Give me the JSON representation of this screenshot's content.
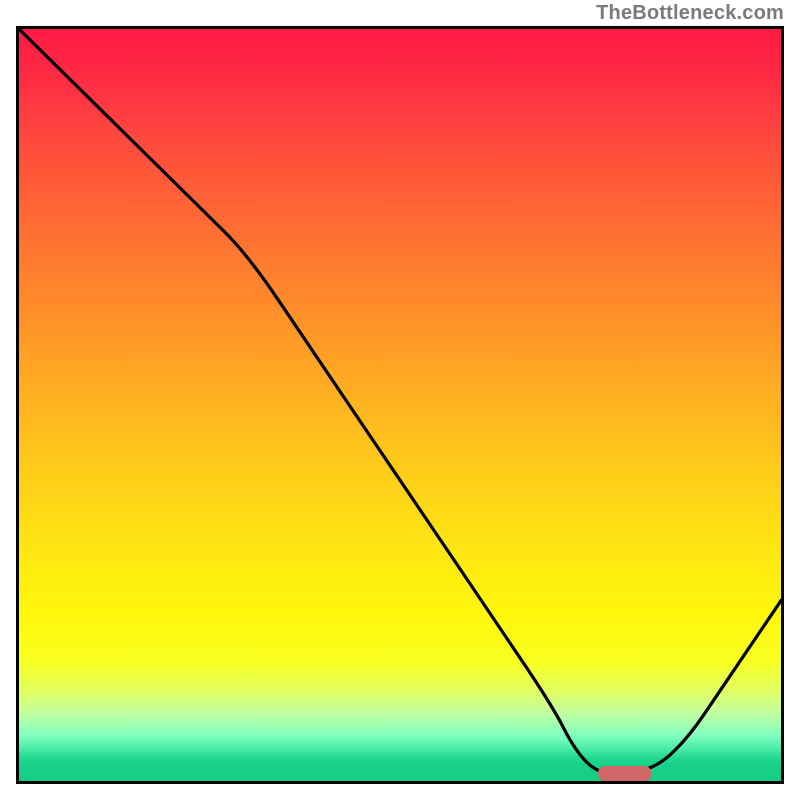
{
  "watermark": "TheBottleneck.com",
  "chart_data": {
    "type": "line",
    "title": "",
    "xlabel": "",
    "ylabel": "",
    "xlim": [
      0,
      100
    ],
    "ylim": [
      0,
      100
    ],
    "grid": false,
    "legend": false,
    "series": [
      {
        "name": "bottleneck-curve",
        "x": [
          0,
          8,
          16,
          24,
          30,
          38,
          46,
          54,
          62,
          70,
          73,
          76,
          80,
          84,
          88,
          92,
          96,
          100
        ],
        "y": [
          100,
          92,
          84,
          76,
          70,
          58,
          46,
          34,
          22,
          10,
          4,
          1,
          1,
          2,
          6,
          12,
          18,
          24
        ]
      }
    ],
    "marker": {
      "name": "optimal-range",
      "x_start": 76,
      "x_end": 83,
      "y": 1,
      "color": "#d06868"
    },
    "background_gradient": {
      "top": "#ff1a44",
      "mid": "#ffe812",
      "bottom": "#14cc84"
    }
  }
}
